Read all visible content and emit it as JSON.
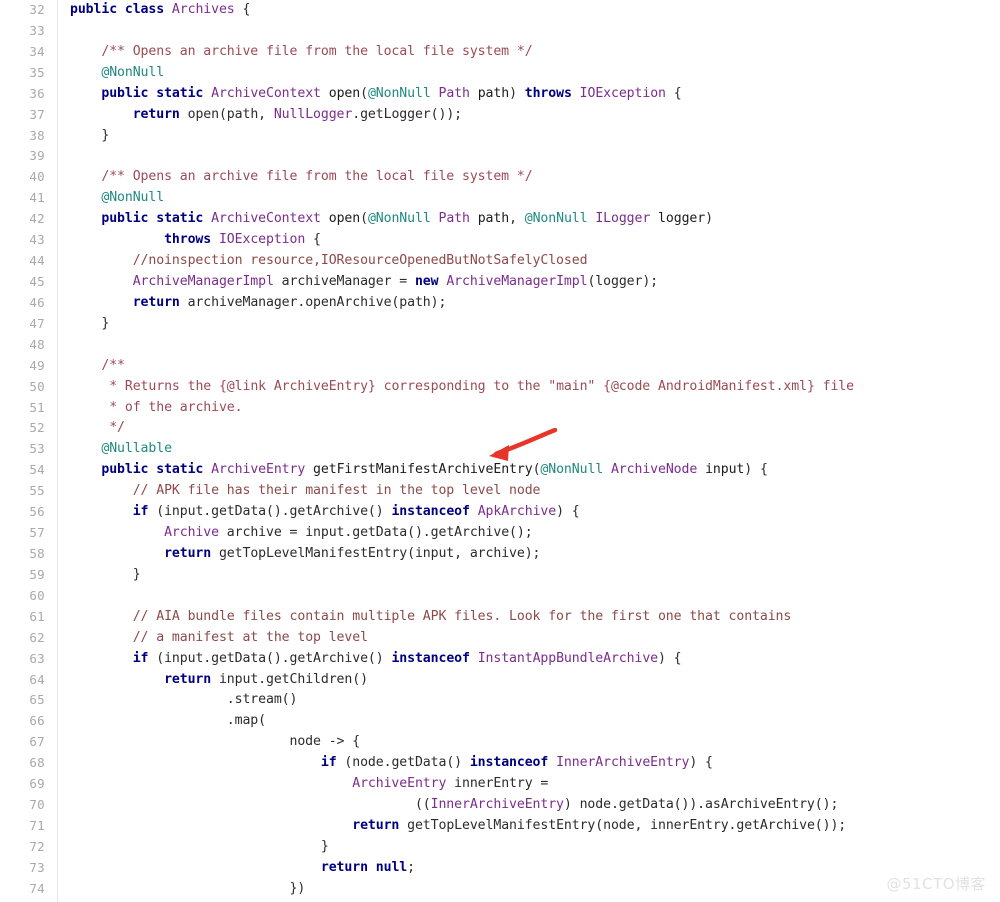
{
  "viewer": {
    "language": "java",
    "first_line_number": 32,
    "last_line_number": 74,
    "background_color": "#ffffff",
    "gutter_text_color": "#a9a9a9",
    "gutter_divider_color": "#e4e4e4"
  },
  "palette": {
    "keyword": "#000080",
    "type": "#7b2d8e",
    "annotation": "#1f8a80",
    "comment": "#8d4a4a",
    "javadoc": "#9b4b55",
    "plain": "#2b2b2b",
    "arrow": "#e8352a",
    "watermark": "#e2e2e2"
  },
  "annotation_arrow": {
    "name": "red-arrow-pointing-left",
    "color": "#e8352a",
    "points_to_line": 54,
    "points_to_token": "getFirstManifestArchiveEntry"
  },
  "watermark": {
    "text": "@51CTO博客"
  },
  "lines": [
    {
      "n": 32,
      "tokens": [
        {
          "c": "kw",
          "t": "public class "
        },
        {
          "c": "type",
          "t": "Archives"
        },
        {
          "c": "plain",
          "t": " {"
        }
      ]
    },
    {
      "n": 33,
      "tokens": []
    },
    {
      "n": 34,
      "tokens": [
        {
          "c": "plain",
          "t": "    "
        },
        {
          "c": "doc",
          "t": "/** Opens an archive file from the local file system */"
        }
      ]
    },
    {
      "n": 35,
      "tokens": [
        {
          "c": "plain",
          "t": "    "
        },
        {
          "c": "anno",
          "t": "@NonNull"
        }
      ]
    },
    {
      "n": 36,
      "tokens": [
        {
          "c": "plain",
          "t": "    "
        },
        {
          "c": "kw",
          "t": "public static "
        },
        {
          "c": "type",
          "t": "ArchiveContext"
        },
        {
          "c": "plain",
          "t": " "
        },
        {
          "c": "mth",
          "t": "open"
        },
        {
          "c": "plain",
          "t": "("
        },
        {
          "c": "anno",
          "t": "@NonNull"
        },
        {
          "c": "plain",
          "t": " "
        },
        {
          "c": "type",
          "t": "Path"
        },
        {
          "c": "plain",
          "t": " "
        },
        {
          "c": "mth",
          "t": "path"
        },
        {
          "c": "plain",
          "t": ") "
        },
        {
          "c": "kw",
          "t": "throws"
        },
        {
          "c": "plain",
          "t": " "
        },
        {
          "c": "type",
          "t": "IOException"
        },
        {
          "c": "plain",
          "t": " {"
        }
      ]
    },
    {
      "n": 37,
      "tokens": [
        {
          "c": "plain",
          "t": "        "
        },
        {
          "c": "kw",
          "t": "return"
        },
        {
          "c": "plain",
          "t": " open(path, "
        },
        {
          "c": "type",
          "t": "NullLogger"
        },
        {
          "c": "plain",
          "t": ".getLogger());"
        }
      ]
    },
    {
      "n": 38,
      "tokens": [
        {
          "c": "plain",
          "t": "    }"
        }
      ]
    },
    {
      "n": 39,
      "tokens": []
    },
    {
      "n": 40,
      "tokens": [
        {
          "c": "plain",
          "t": "    "
        },
        {
          "c": "doc",
          "t": "/** Opens an archive file from the local file system */"
        }
      ]
    },
    {
      "n": 41,
      "tokens": [
        {
          "c": "plain",
          "t": "    "
        },
        {
          "c": "anno",
          "t": "@NonNull"
        }
      ]
    },
    {
      "n": 42,
      "tokens": [
        {
          "c": "plain",
          "t": "    "
        },
        {
          "c": "kw",
          "t": "public static "
        },
        {
          "c": "type",
          "t": "ArchiveContext"
        },
        {
          "c": "plain",
          "t": " "
        },
        {
          "c": "mth",
          "t": "open"
        },
        {
          "c": "plain",
          "t": "("
        },
        {
          "c": "anno",
          "t": "@NonNull"
        },
        {
          "c": "plain",
          "t": " "
        },
        {
          "c": "type",
          "t": "Path"
        },
        {
          "c": "plain",
          "t": " "
        },
        {
          "c": "mth",
          "t": "path"
        },
        {
          "c": "plain",
          "t": ", "
        },
        {
          "c": "anno",
          "t": "@NonNull"
        },
        {
          "c": "plain",
          "t": " "
        },
        {
          "c": "type",
          "t": "ILogger"
        },
        {
          "c": "plain",
          "t": " "
        },
        {
          "c": "mth",
          "t": "logger"
        },
        {
          "c": "plain",
          "t": ")"
        }
      ]
    },
    {
      "n": 43,
      "tokens": [
        {
          "c": "plain",
          "t": "            "
        },
        {
          "c": "kw",
          "t": "throws"
        },
        {
          "c": "plain",
          "t": " "
        },
        {
          "c": "type",
          "t": "IOException"
        },
        {
          "c": "plain",
          "t": " {"
        }
      ]
    },
    {
      "n": 44,
      "tokens": [
        {
          "c": "plain",
          "t": "        "
        },
        {
          "c": "cmt",
          "t": "//noinspection resource,IOResourceOpenedButNotSafelyClosed"
        }
      ]
    },
    {
      "n": 45,
      "tokens": [
        {
          "c": "plain",
          "t": "        "
        },
        {
          "c": "type",
          "t": "ArchiveManagerImpl"
        },
        {
          "c": "plain",
          "t": " archiveManager = "
        },
        {
          "c": "kw",
          "t": "new"
        },
        {
          "c": "plain",
          "t": " "
        },
        {
          "c": "type",
          "t": "ArchiveManagerImpl"
        },
        {
          "c": "plain",
          "t": "(logger);"
        }
      ]
    },
    {
      "n": 46,
      "tokens": [
        {
          "c": "plain",
          "t": "        "
        },
        {
          "c": "kw",
          "t": "return"
        },
        {
          "c": "plain",
          "t": " archiveManager.openArchive(path);"
        }
      ]
    },
    {
      "n": 47,
      "tokens": [
        {
          "c": "plain",
          "t": "    }"
        }
      ]
    },
    {
      "n": 48,
      "tokens": []
    },
    {
      "n": 49,
      "tokens": [
        {
          "c": "plain",
          "t": "    "
        },
        {
          "c": "doc",
          "t": "/**"
        }
      ]
    },
    {
      "n": 50,
      "tokens": [
        {
          "c": "plain",
          "t": "     "
        },
        {
          "c": "doc",
          "t": "* Returns the {@link "
        },
        {
          "c": "doctag",
          "t": "ArchiveEntry"
        },
        {
          "c": "doc",
          "t": "} corresponding to the \"main\" {@code "
        },
        {
          "c": "doctag",
          "t": "AndroidManifest.xml"
        },
        {
          "c": "doc",
          "t": "} file"
        }
      ]
    },
    {
      "n": 51,
      "tokens": [
        {
          "c": "plain",
          "t": "     "
        },
        {
          "c": "doc",
          "t": "* of the archive."
        }
      ]
    },
    {
      "n": 52,
      "tokens": [
        {
          "c": "plain",
          "t": "     "
        },
        {
          "c": "doc",
          "t": "*/"
        }
      ]
    },
    {
      "n": 53,
      "tokens": [
        {
          "c": "plain",
          "t": "    "
        },
        {
          "c": "anno",
          "t": "@Nullable"
        }
      ]
    },
    {
      "n": 54,
      "tokens": [
        {
          "c": "plain",
          "t": "    "
        },
        {
          "c": "kw",
          "t": "public static "
        },
        {
          "c": "type",
          "t": "ArchiveEntry"
        },
        {
          "c": "plain",
          "t": " "
        },
        {
          "c": "mth",
          "t": "getFirstManifestArchiveEntry"
        },
        {
          "c": "plain",
          "t": "("
        },
        {
          "c": "anno",
          "t": "@NonNull"
        },
        {
          "c": "plain",
          "t": " "
        },
        {
          "c": "type",
          "t": "ArchiveNode"
        },
        {
          "c": "plain",
          "t": " "
        },
        {
          "c": "mth",
          "t": "input"
        },
        {
          "c": "plain",
          "t": ") {"
        }
      ]
    },
    {
      "n": 55,
      "tokens": [
        {
          "c": "plain",
          "t": "        "
        },
        {
          "c": "cmt",
          "t": "// APK file has their manifest in the top level node"
        }
      ]
    },
    {
      "n": 56,
      "tokens": [
        {
          "c": "plain",
          "t": "        "
        },
        {
          "c": "kw",
          "t": "if"
        },
        {
          "c": "plain",
          "t": " (input.getData().getArchive() "
        },
        {
          "c": "kw",
          "t": "instanceof"
        },
        {
          "c": "plain",
          "t": " "
        },
        {
          "c": "type",
          "t": "ApkArchive"
        },
        {
          "c": "plain",
          "t": ") {"
        }
      ]
    },
    {
      "n": 57,
      "tokens": [
        {
          "c": "plain",
          "t": "            "
        },
        {
          "c": "type",
          "t": "Archive"
        },
        {
          "c": "plain",
          "t": " archive = input.getData().getArchive();"
        }
      ]
    },
    {
      "n": 58,
      "tokens": [
        {
          "c": "plain",
          "t": "            "
        },
        {
          "c": "kw",
          "t": "return"
        },
        {
          "c": "plain",
          "t": " getTopLevelManifestEntry(input, archive);"
        }
      ]
    },
    {
      "n": 59,
      "tokens": [
        {
          "c": "plain",
          "t": "        }"
        }
      ]
    },
    {
      "n": 60,
      "tokens": []
    },
    {
      "n": 61,
      "tokens": [
        {
          "c": "plain",
          "t": "        "
        },
        {
          "c": "cmt",
          "t": "// AIA bundle files contain multiple APK files. Look for the first one that contains"
        }
      ]
    },
    {
      "n": 62,
      "tokens": [
        {
          "c": "plain",
          "t": "        "
        },
        {
          "c": "cmt",
          "t": "// a manifest at the top level"
        }
      ]
    },
    {
      "n": 63,
      "tokens": [
        {
          "c": "plain",
          "t": "        "
        },
        {
          "c": "kw",
          "t": "if"
        },
        {
          "c": "plain",
          "t": " (input.getData().getArchive() "
        },
        {
          "c": "kw",
          "t": "instanceof"
        },
        {
          "c": "plain",
          "t": " "
        },
        {
          "c": "type",
          "t": "InstantAppBundleArchive"
        },
        {
          "c": "plain",
          "t": ") {"
        }
      ]
    },
    {
      "n": 64,
      "tokens": [
        {
          "c": "plain",
          "t": "            "
        },
        {
          "c": "kw",
          "t": "return"
        },
        {
          "c": "plain",
          "t": " input.getChildren()"
        }
      ]
    },
    {
      "n": 65,
      "tokens": [
        {
          "c": "plain",
          "t": "                    .stream()"
        }
      ]
    },
    {
      "n": 66,
      "tokens": [
        {
          "c": "plain",
          "t": "                    .map("
        }
      ]
    },
    {
      "n": 67,
      "tokens": [
        {
          "c": "plain",
          "t": "                            node -> {"
        }
      ]
    },
    {
      "n": 68,
      "tokens": [
        {
          "c": "plain",
          "t": "                                "
        },
        {
          "c": "kw",
          "t": "if"
        },
        {
          "c": "plain",
          "t": " (node.getData() "
        },
        {
          "c": "kw",
          "t": "instanceof"
        },
        {
          "c": "plain",
          "t": " "
        },
        {
          "c": "type",
          "t": "InnerArchiveEntry"
        },
        {
          "c": "plain",
          "t": ") {"
        }
      ]
    },
    {
      "n": 69,
      "tokens": [
        {
          "c": "plain",
          "t": "                                    "
        },
        {
          "c": "type",
          "t": "ArchiveEntry"
        },
        {
          "c": "plain",
          "t": " innerEntry ="
        }
      ]
    },
    {
      "n": 70,
      "tokens": [
        {
          "c": "plain",
          "t": "                                            (("
        },
        {
          "c": "type",
          "t": "InnerArchiveEntry"
        },
        {
          "c": "plain",
          "t": ") node.getData()).asArchiveEntry();"
        }
      ]
    },
    {
      "n": 71,
      "tokens": [
        {
          "c": "plain",
          "t": "                                    "
        },
        {
          "c": "kw",
          "t": "return"
        },
        {
          "c": "plain",
          "t": " getTopLevelManifestEntry(node, innerEntry.getArchive());"
        }
      ]
    },
    {
      "n": 72,
      "tokens": [
        {
          "c": "plain",
          "t": "                                }"
        }
      ]
    },
    {
      "n": 73,
      "tokens": [
        {
          "c": "plain",
          "t": "                                "
        },
        {
          "c": "kw",
          "t": "return"
        },
        {
          "c": "plain",
          "t": " "
        },
        {
          "c": "kw",
          "t": "null"
        },
        {
          "c": "plain",
          "t": ";"
        }
      ]
    },
    {
      "n": 74,
      "tokens": [
        {
          "c": "plain",
          "t": "                            })"
        }
      ]
    }
  ]
}
